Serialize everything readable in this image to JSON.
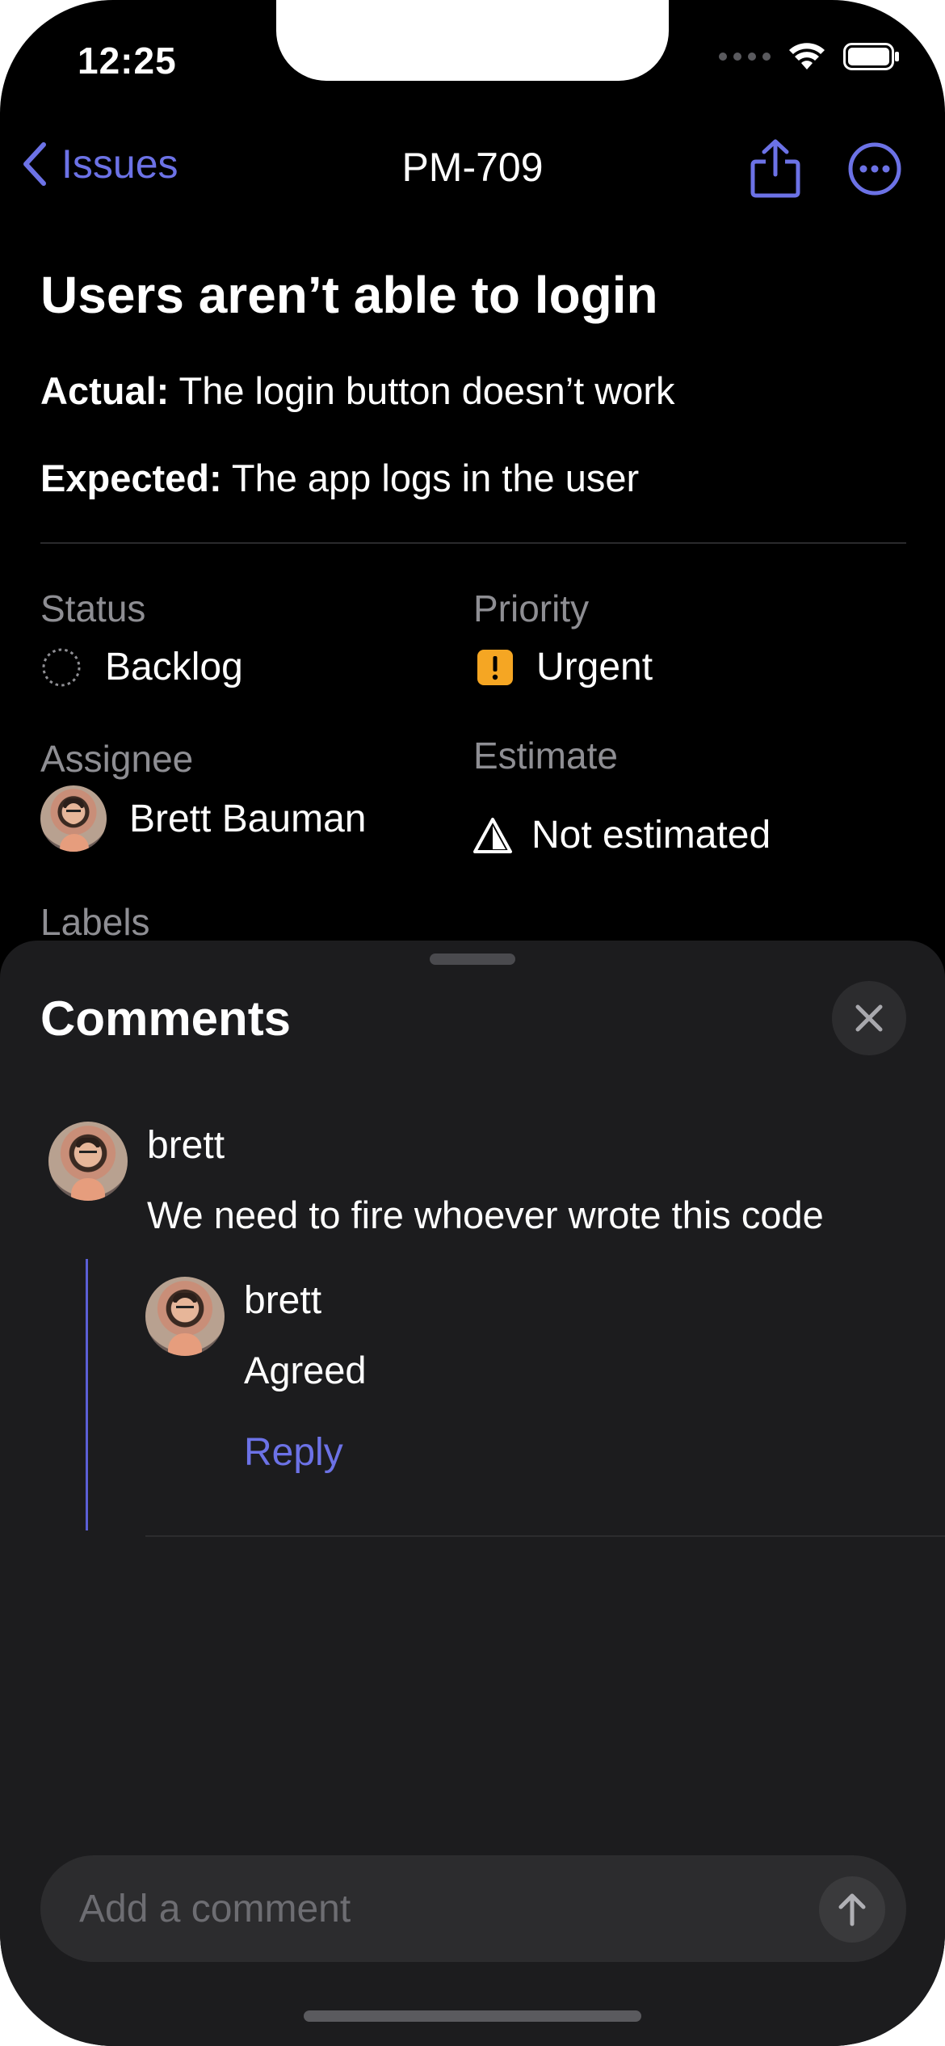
{
  "status_bar": {
    "time": "12:25"
  },
  "nav": {
    "back_label": "Issues",
    "title": "PM-709"
  },
  "issue": {
    "title": "Users aren’t able to login",
    "actual_label": "Actual:",
    "actual_text": "The login button doesn’t work",
    "expected_label": "Expected:",
    "expected_text": "The app logs in the user"
  },
  "properties": {
    "status": {
      "label": "Status",
      "value": "Backlog"
    },
    "priority": {
      "label": "Priority",
      "value": "Urgent",
      "color": "#f5a623"
    },
    "assignee": {
      "label": "Assignee",
      "value": "Brett Bauman"
    },
    "estimate": {
      "label": "Estimate",
      "value": "Not estimated"
    },
    "labels": {
      "label": "Labels"
    }
  },
  "comments_sheet": {
    "title": "Comments",
    "comments": [
      {
        "author": "brett",
        "text": "We need to fire whoever wrote this code"
      }
    ],
    "replies": [
      {
        "author": "brett",
        "text": "Agreed"
      }
    ],
    "reply_label": "Reply",
    "composer_placeholder": "Add a comment"
  },
  "colors": {
    "accent": "#6c72e6",
    "background": "#000000",
    "sheet": "#1c1c1e",
    "secondary_text": "#8e8e93"
  }
}
